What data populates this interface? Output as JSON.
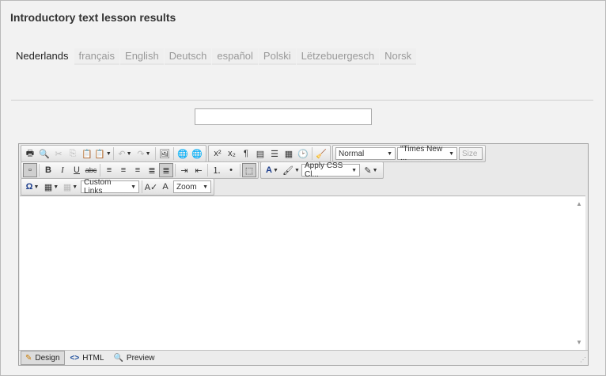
{
  "title": "Introductory text lesson results",
  "languages": [
    "Nederlands",
    "français",
    "English",
    "Deutsch",
    "español",
    "Polski",
    "Lëtzebuergesch",
    "Norsk"
  ],
  "active_language": "Nederlands",
  "title_input": {
    "value": ""
  },
  "toolbar": {
    "format_select": "Normal",
    "font_select": "\"Times New ...",
    "size_select": "Size",
    "css_select": "Apply CSS Cl...",
    "links_select": "Custom Links",
    "zoom_select": "Zoom"
  },
  "modes": {
    "design": "Design",
    "html": "HTML",
    "preview": "Preview"
  }
}
